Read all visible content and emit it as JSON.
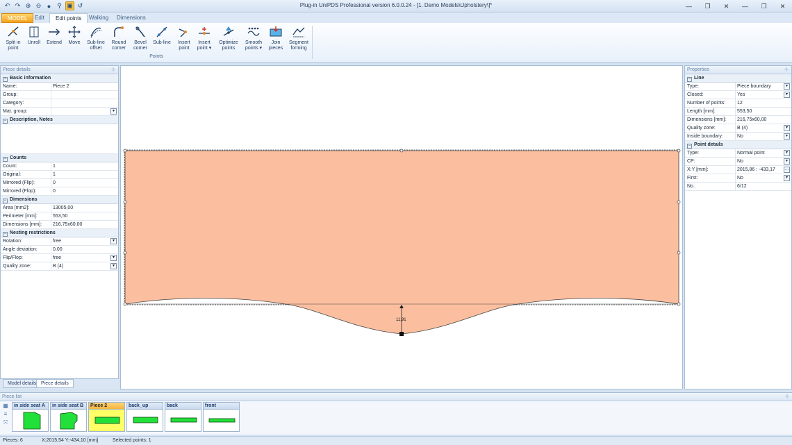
{
  "titlebar": {
    "title": "Plug-in UniPDS Professional version 6.0.0.24 - [1. Demo Models\\Upholstery\\]*",
    "quick_access": [
      "undo-icon",
      "redo-icon",
      "zoom-in-icon",
      "zoom-out-icon",
      "zoom-fit-icon",
      "search-icon",
      "highlight-icon",
      "undo-arrow-icon"
    ],
    "window_buttons": [
      "—",
      "❐",
      "✕",
      "—",
      "❐",
      "✕"
    ]
  },
  "tabs": {
    "model": "MODEL",
    "edit": "Edit",
    "edit_points": "Edit points",
    "walking": "Walking",
    "dimensions": "Dimensions"
  },
  "ribbon": {
    "group_label": "Points",
    "buttons": [
      {
        "label": "Split in\npoint",
        "icon": "split-in-point-icon"
      },
      {
        "label": "Unroll",
        "icon": "unroll-icon"
      },
      {
        "label": "Extend",
        "icon": "extend-icon"
      },
      {
        "label": "Move",
        "icon": "move-icon"
      },
      {
        "label": "Sub-line\noffset",
        "icon": "sub-line-offset-icon"
      },
      {
        "label": "Round\ncorner",
        "icon": "round-corner-icon"
      },
      {
        "label": "Bevel\ncorner",
        "icon": "bevel-corner-icon"
      },
      {
        "label": "Sub-line",
        "icon": "sub-line-icon"
      },
      {
        "label": "Insert\npoint",
        "icon": "insert-point-icon"
      },
      {
        "label": "Insert\npoint ▾",
        "icon": "insert-point-menu-icon"
      },
      {
        "label": "Optimize\npoints",
        "icon": "optimize-points-icon"
      },
      {
        "label": "Smooth\npoints ▾",
        "icon": "smooth-points-icon"
      },
      {
        "label": "Join\npieces",
        "icon": "join-pieces-icon"
      },
      {
        "label": "Segment\nforming",
        "icon": "segment-forming-icon"
      }
    ]
  },
  "piece_details": {
    "title": "Piece details",
    "basic_header": "Basic information",
    "name_k": "Name:",
    "name_v": "Piece 2",
    "group_k": "Group:",
    "group_v": "",
    "category_k": "Category:",
    "category_v": "",
    "matgroup_k": "Mat. group:",
    "matgroup_v": "",
    "desc_header": "Description, Notes",
    "counts_header": "Counts",
    "count_k": "Count:",
    "count_v": "1",
    "original_k": "Original:",
    "original_v": "1",
    "mflip_k": "Mirrored (Flip):",
    "mflip_v": "0",
    "mflop_k": "Mirrored (Flop):",
    "mflop_v": "0",
    "dims_header": "Dimensions",
    "area_k": "Area [mm2]:",
    "area_v": "13005,00",
    "perim_k": "Perimeter [mm]:",
    "perim_v": "553,50",
    "dimmm_k": "Dimensions [mm]:",
    "dimmm_v": "216,75x60,00",
    "nest_header": "Nesting restrictions",
    "rot_k": "Rotation:",
    "rot_v": "free",
    "angle_k": "Angle deviation:",
    "angle_v": "0,00",
    "flip_k": "Flip/Flop:",
    "flip_v": "free",
    "qz_k": "Quality zone:",
    "qz_v": "B (4)"
  },
  "left_tabs": {
    "model_details": "Model details",
    "piece_details": "Piece details"
  },
  "properties": {
    "title": "Properties",
    "line_header": "Line",
    "type_k": "Type:",
    "type_v": "Piece boundary",
    "closed_k": "Closed:",
    "closed_v": "Yes",
    "npts_k": "Number of points:",
    "npts_v": "12",
    "len_k": "Length [mm]:",
    "len_v": "553,50",
    "dim_k": "Dimensions [mm]:",
    "dim_v": "216,75x60,00",
    "qz_k": "Quality zone:",
    "qz_v": "B (4)",
    "inside_k": "Inside boundary:",
    "inside_v": "No",
    "pd_header": "Point details",
    "ptype_k": "Type:",
    "ptype_v": "Normal point",
    "cp_k": "CP:",
    "cp_v": "No",
    "xy_k": "X:Y [mm]:",
    "xy_v": "2015,86 : -433,17",
    "first_k": "First:",
    "first_v": "No",
    "no_k": "No.",
    "no_v": "6/12"
  },
  "canvas": {
    "dimension_label": "11,91",
    "piece_fill": "#fbbf9f"
  },
  "piece_list": {
    "title": "Piece list",
    "items": [
      {
        "label": "in side seat A"
      },
      {
        "label": "in side seat B"
      },
      {
        "label": "Piece 2"
      },
      {
        "label": "back_up"
      },
      {
        "label": "back"
      },
      {
        "label": "front"
      }
    ]
  },
  "status": {
    "pieces": "Pieces: 6",
    "coords": "X:2015,54  Y:-434,10 [mm]",
    "selected": "Selected points: 1"
  }
}
